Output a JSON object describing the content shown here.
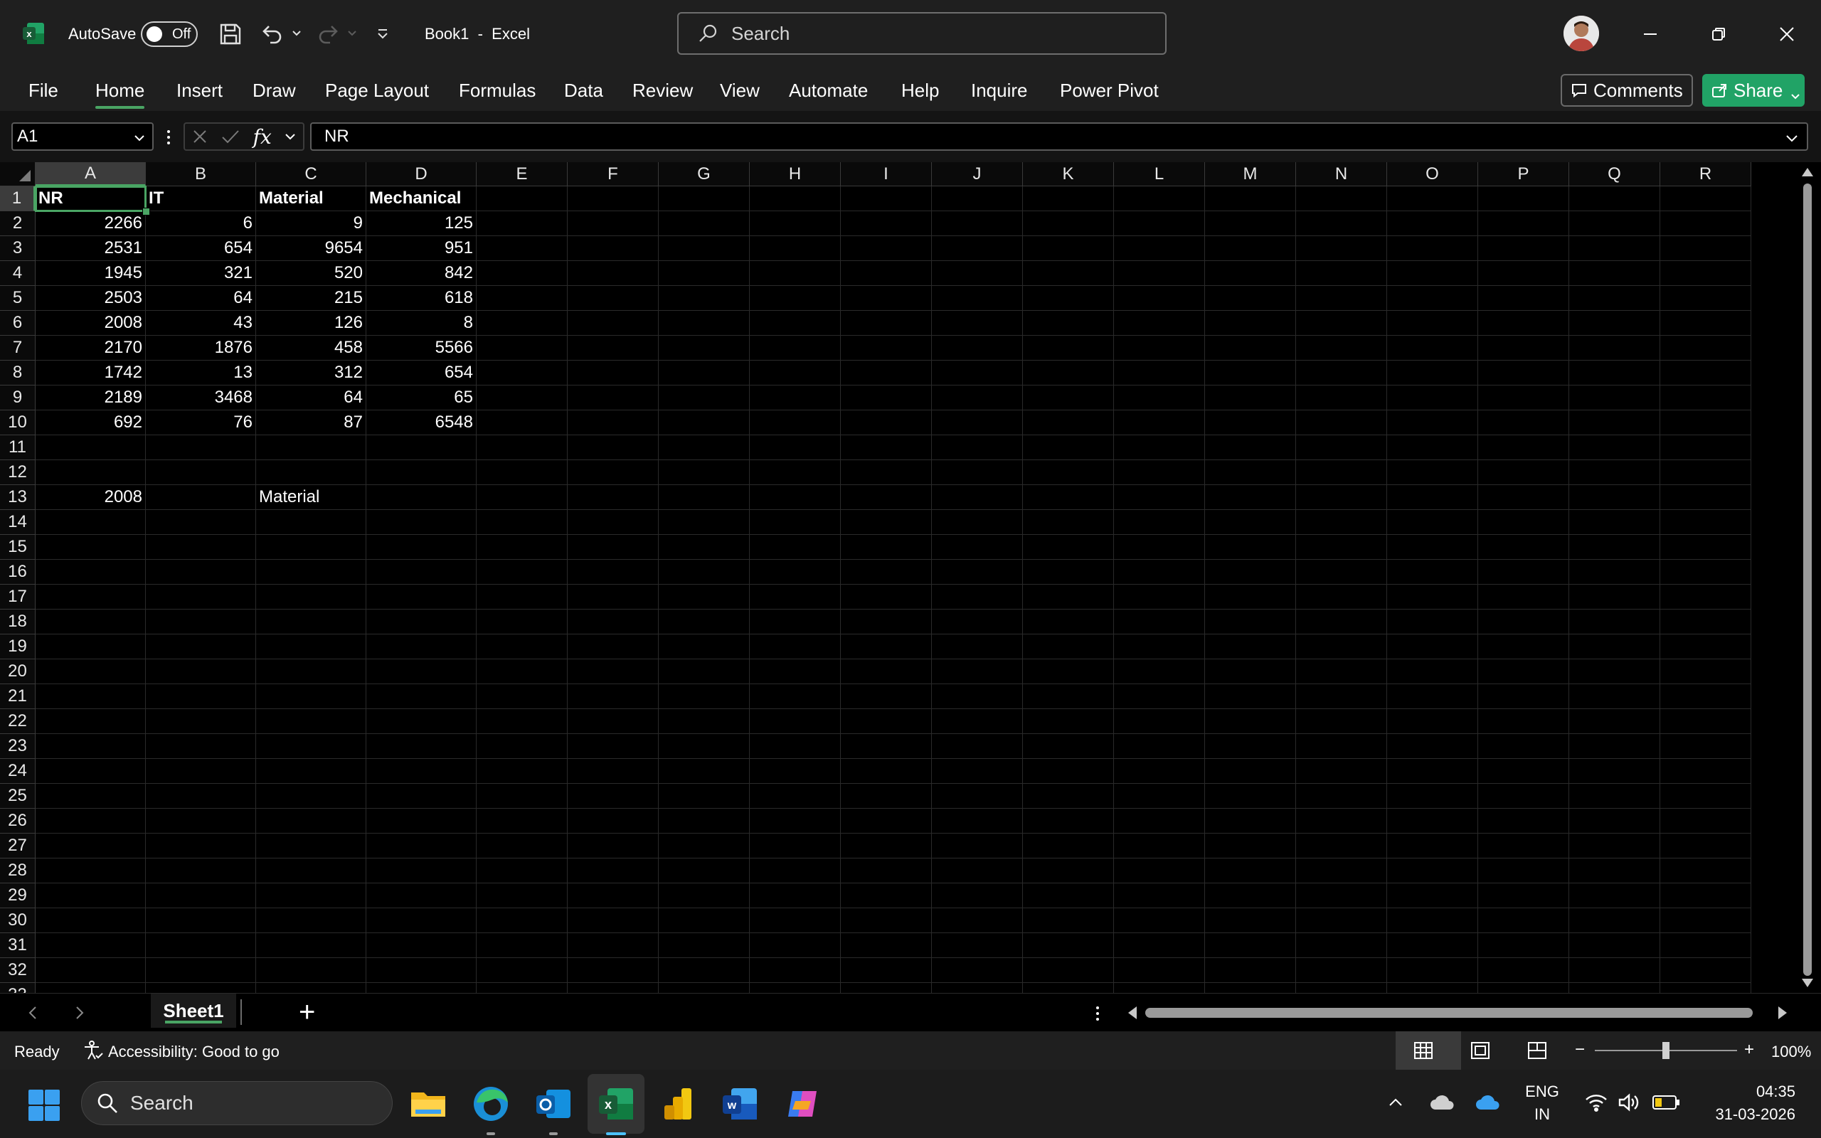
{
  "titlebar": {
    "autosave_label": "AutoSave",
    "autosave_state": "Off",
    "doc_title": "Book1  -  Excel",
    "search_placeholder": "Search"
  },
  "ribbon": {
    "tabs": [
      "File",
      "Home",
      "Insert",
      "Draw",
      "Page Layout",
      "Formulas",
      "Data",
      "Review",
      "View",
      "Automate",
      "Help",
      "Inquire",
      "Power Pivot"
    ],
    "active_tab": "Home",
    "comments_label": "Comments",
    "share_label": "Share"
  },
  "formula_bar": {
    "name_box": "A1",
    "fx_label": "fx",
    "content": "NR"
  },
  "sheet": {
    "columns": [
      "A",
      "B",
      "C",
      "D",
      "E",
      "F",
      "G",
      "H",
      "I",
      "J",
      "K",
      "L",
      "M",
      "N",
      "O",
      "P",
      "Q",
      "R"
    ],
    "selected_column": "A",
    "selected_row": 1,
    "row_count": 32,
    "cells": {
      "A1": "NR",
      "B1": "IT",
      "C1": "Material",
      "D1": "Mechanical",
      "A2": "2266",
      "B2": "6",
      "C2": "9",
      "D2": "125",
      "A3": "2531",
      "B3": "654",
      "C3": "9654",
      "D3": "951",
      "A4": "1945",
      "B4": "321",
      "C4": "520",
      "D4": "842",
      "A5": "2503",
      "B5": "64",
      "C5": "215",
      "D5": "618",
      "A6": "2008",
      "B6": "43",
      "C6": "126",
      "D6": "8",
      "A7": "2170",
      "B7": "1876",
      "C7": "458",
      "D7": "5566",
      "A8": "1742",
      "B8": "13",
      "C8": "312",
      "D8": "654",
      "A9": "2189",
      "B9": "3468",
      "C9": "64",
      "D9": "65",
      "A10": "692",
      "B10": "76",
      "C10": "87",
      "D10": "6548",
      "A13": "2008",
      "C13": "Material"
    },
    "bold_row": 1,
    "text_cells": [
      "A1",
      "B1",
      "C1",
      "D1",
      "C13"
    ]
  },
  "sheet_tabs": {
    "tabs": [
      "Sheet1"
    ],
    "active": "Sheet1",
    "add_label": "+"
  },
  "statusbar": {
    "ready": "Ready",
    "accessibility": "Accessibility: Good to go",
    "zoom": "100%",
    "zoom_minus": "−",
    "zoom_plus": "+"
  },
  "taskbar": {
    "search_placeholder": "Search",
    "lang_top": "ENG",
    "lang_bottom": "IN",
    "time": "04:35",
    "date": "31-03-2026"
  },
  "colors": {
    "accent": "#4aa564",
    "share_bg": "#21a366",
    "chrome": "#1f1f1f"
  }
}
